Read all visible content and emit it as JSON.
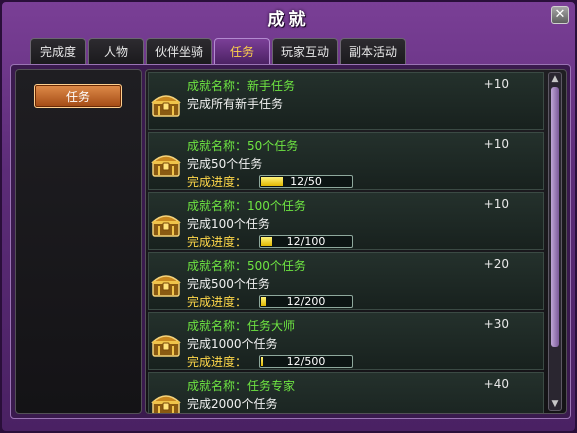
{
  "window": {
    "title": "成就",
    "close_glyph": "✕"
  },
  "tabs": [
    {
      "label": "完成度",
      "active": false
    },
    {
      "label": "人物",
      "active": false
    },
    {
      "label": "伙伴坐骑",
      "active": false
    },
    {
      "label": "任务",
      "active": true
    },
    {
      "label": "玩家互动",
      "active": false
    },
    {
      "label": "副本活动",
      "active": false
    }
  ],
  "category": {
    "selected_label": "任务"
  },
  "achievements": [
    {
      "name_label": "成就名称：",
      "name": "新手任务",
      "points": "+10",
      "desc": "完成所有新手任务",
      "progress": null
    },
    {
      "name_label": "成就名称：",
      "name": "50个任务",
      "points": "+10",
      "desc": "完成50个任务",
      "progress": {
        "label": "完成进度：",
        "current": 12,
        "total": 50,
        "text": "12/50"
      }
    },
    {
      "name_label": "成就名称：",
      "name": "100个任务",
      "points": "+10",
      "desc": "完成100个任务",
      "progress": {
        "label": "完成进度：",
        "current": 12,
        "total": 100,
        "text": "12/100"
      }
    },
    {
      "name_label": "成就名称：",
      "name": "500个任务",
      "points": "+20",
      "desc": "完成500个任务",
      "progress": {
        "label": "完成进度：",
        "current": 12,
        "total": 200,
        "text": "12/200"
      }
    },
    {
      "name_label": "成就名称：",
      "name": "任务大师",
      "points": "+30",
      "desc": "完成1000个任务",
      "progress": {
        "label": "完成进度：",
        "current": 12,
        "total": 500,
        "text": "12/500"
      }
    },
    {
      "name_label": "成就名称：",
      "name": "任务专家",
      "points": "+40",
      "desc": "完成2000个任务",
      "progress": null
    }
  ],
  "icons": {
    "chest": "treasure-chest-icon",
    "scroll_up": "▲",
    "scroll_down": "▼"
  },
  "colors": {
    "name_green": "#6ee542",
    "progress_yellow": "#ffd84a",
    "active_tab_text": "#ffd24a"
  }
}
